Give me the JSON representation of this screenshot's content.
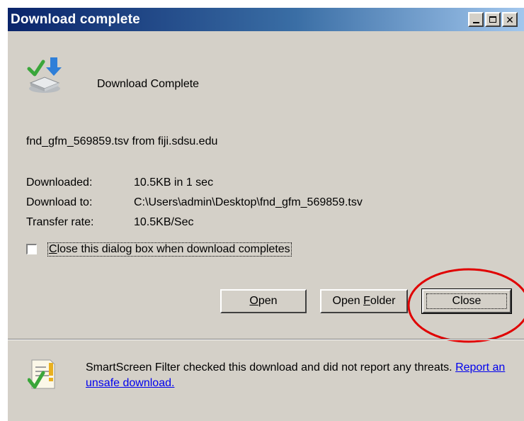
{
  "window": {
    "title": "Download complete",
    "titlebar_colors": [
      "#0a246a",
      "#a6caf0"
    ]
  },
  "header": {
    "icon": "download-icon",
    "status_text": "Download Complete"
  },
  "file_line": "fnd_gfm_569859.tsv from fiji.sdsu.edu",
  "details": {
    "downloaded_label": "Downloaded:",
    "downloaded_value": "10.5KB in 1 sec",
    "download_to_label": "Download to:",
    "download_to_value": "C:\\Users\\admin\\Desktop\\fnd_gfm_569859.tsv",
    "transfer_rate_label": "Transfer rate:",
    "transfer_rate_value": "10.5KB/Sec"
  },
  "close_on_complete": {
    "checked": false,
    "label_prefix": "",
    "label_accel": "C",
    "label_rest": "lose this dialog box when download completes"
  },
  "buttons": {
    "open": {
      "accel": "O",
      "rest": "pen"
    },
    "open_folder": {
      "prefix": "Open ",
      "accel": "F",
      "rest": "older"
    },
    "close": "Close"
  },
  "annotation": {
    "color": "#e00000",
    "target": "close-button"
  },
  "smartscreen": {
    "icon": "smartscreen-check-icon",
    "text": "SmartScreen Filter checked this download and did not report any threats.",
    "link": "Report an unsafe download."
  }
}
